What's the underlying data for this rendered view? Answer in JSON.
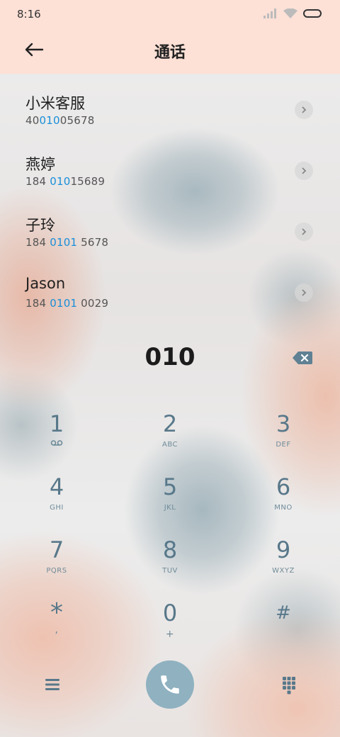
{
  "status_bar": {
    "time": "8:16"
  },
  "header": {
    "title": "通话"
  },
  "suggestions": [
    {
      "name": "小米客服",
      "number_pre": "40",
      "number_match": "010",
      "number_post": "05678"
    },
    {
      "name": "燕婷",
      "number_pre": "184 ",
      "number_match": "010",
      "number_post": "15689"
    },
    {
      "name": "子玲",
      "number_pre": "184 ",
      "number_match": "0101",
      "number_post": " 5678"
    },
    {
      "name": "Jason",
      "number_pre": "184 ",
      "number_match": "0101",
      "number_post": " 0029"
    }
  ],
  "dialer": {
    "number": "010"
  },
  "keypad": [
    {
      "digit": "1",
      "letters": ""
    },
    {
      "digit": "2",
      "letters": "ABC"
    },
    {
      "digit": "3",
      "letters": "DEF"
    },
    {
      "digit": "4",
      "letters": "GHI"
    },
    {
      "digit": "5",
      "letters": "JKL"
    },
    {
      "digit": "6",
      "letters": "MNO"
    },
    {
      "digit": "7",
      "letters": "PQRS"
    },
    {
      "digit": "8",
      "letters": "TUV"
    },
    {
      "digit": "9",
      "letters": "WXYZ"
    },
    {
      "digit": "*",
      "letters": ","
    },
    {
      "digit": "0",
      "letters": "+"
    },
    {
      "digit": "#",
      "letters": ""
    }
  ],
  "icons": {
    "back": "arrow-left-icon",
    "chevron": "chevron-right-icon",
    "backspace": "backspace-icon",
    "voicemail": "voicemail-icon",
    "menu": "menu-icon",
    "call": "phone-icon",
    "dialpad": "dialpad-icon"
  },
  "colors": {
    "header_bg": "#fde0d6",
    "match_highlight": "#1a8fd8",
    "key_text": "#58788a",
    "call_button": "#8fb1c0"
  }
}
